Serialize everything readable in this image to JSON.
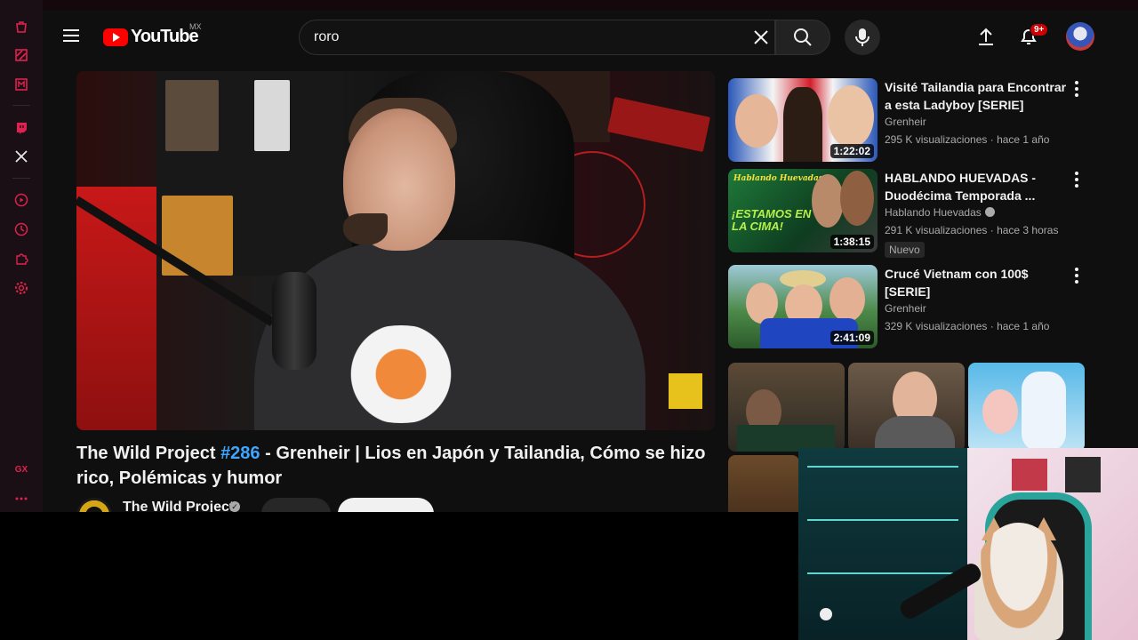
{
  "browser": {
    "rail_icons": [
      "bag-icon",
      "slash-box-icon",
      "m-box-icon",
      "twitch-icon",
      "x-icon",
      "play-circle-icon",
      "clock-icon",
      "puzzle-icon",
      "gear-icon",
      "gx-icon",
      "more-icon"
    ],
    "rail_gx_label": "GX",
    "accent": "#e0214f"
  },
  "header": {
    "logo_text": "YouTube",
    "region": "MX",
    "search_value": "roro",
    "notifications_badge": "9+"
  },
  "video": {
    "title_part1": "The Wild Project ",
    "title_hashtag": "#286",
    "title_part2": " - Grenheir | Lios en Japón y Tailandia, Cómo se hizo rico, Polémicas y humor",
    "channel": "The Wild Project"
  },
  "recommendations": [
    {
      "title": "Visité Tailandia para Encontrar a esta Ladyboy [SERIE]",
      "channel": "Grenheir",
      "verified": false,
      "meta": "295 K visualizaciones · hace 1 año",
      "duration": "1:22:02",
      "badge": ""
    },
    {
      "title": "HABLANDO HUEVADAS - Duodécima Temporada ...",
      "channel": "Hablando Huevadas",
      "verified": true,
      "meta": "291 K visualizaciones · hace 3 horas",
      "duration": "1:38:15",
      "badge": "Nuevo"
    },
    {
      "title": "Crucé Vietnam con 100$ [SERIE]",
      "channel": "Grenheir",
      "verified": false,
      "meta": "329 K visualizaciones · hace 1 año",
      "duration": "2:41:09",
      "badge": ""
    }
  ],
  "thumb_text": {
    "rec2_top": "Hablando Huevadas",
    "rec2_big": "¡ESTAMOS EN LA CIMA!"
  }
}
